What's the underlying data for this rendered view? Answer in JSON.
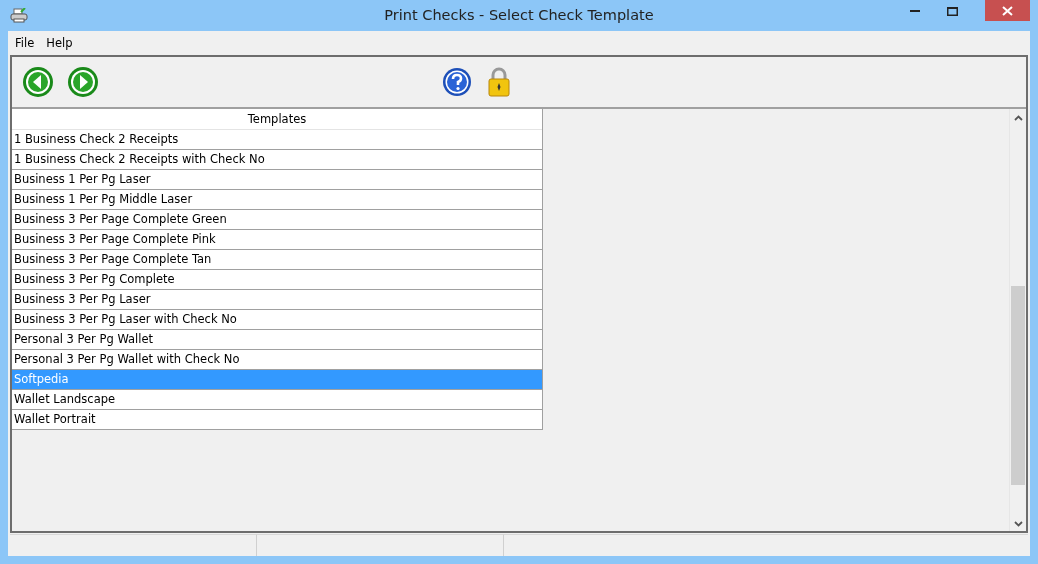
{
  "window": {
    "title": "Print Checks - Select Check Template"
  },
  "menu": [
    "File",
    "Help"
  ],
  "table": {
    "columns": [
      "Templates"
    ],
    "rows": [
      {
        "name": "1 Business Check 2 Receipts",
        "selected": false
      },
      {
        "name": "1 Business Check 2 Receipts with Check No",
        "selected": false
      },
      {
        "name": "Business 1 Per Pg Laser",
        "selected": false
      },
      {
        "name": "Business 1 Per Pg Middle Laser",
        "selected": false
      },
      {
        "name": "Business 3 Per Page Complete Green",
        "selected": false
      },
      {
        "name": "Business 3 Per Page Complete Pink",
        "selected": false
      },
      {
        "name": "Business 3 Per Page Complete Tan",
        "selected": false
      },
      {
        "name": "Business 3 Per Pg Complete",
        "selected": false
      },
      {
        "name": "Business 3 Per Pg Laser",
        "selected": false
      },
      {
        "name": "Business 3 Per Pg Laser with Check No",
        "selected": false
      },
      {
        "name": "Personal 3 Per Pg Wallet",
        "selected": false
      },
      {
        "name": "Personal 3 Per Pg Wallet with Check No",
        "selected": false
      },
      {
        "name": "Softpedia",
        "selected": true
      },
      {
        "name": "Wallet Landscape",
        "selected": false
      },
      {
        "name": "Wallet Portrait",
        "selected": false
      }
    ]
  }
}
